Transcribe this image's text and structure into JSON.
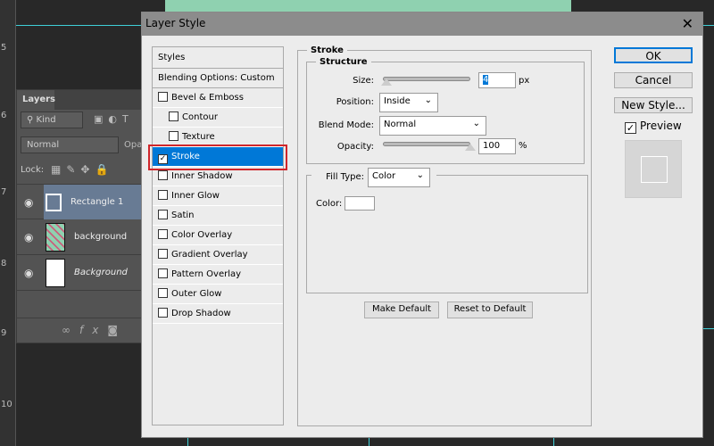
{
  "ruler": {
    "marks": [
      "5",
      "6",
      "7",
      "8",
      "9",
      "10"
    ]
  },
  "layers": {
    "tab": "Layers",
    "kind": "Kind",
    "blend": "Normal",
    "opacity_label": "Opa",
    "lock_label": "Lock:",
    "items": [
      {
        "name": "Rectangle 1",
        "selected": true
      },
      {
        "name": "background"
      },
      {
        "name": "Background"
      }
    ]
  },
  "dialog": {
    "title": "Layer Style",
    "styles_header": "Styles",
    "blending": "Blending Options: Custom",
    "effects": [
      {
        "label": "Bevel & Emboss",
        "checked": false
      },
      {
        "label": "Contour",
        "checked": false
      },
      {
        "label": "Texture",
        "checked": false
      },
      {
        "label": "Stroke",
        "checked": true,
        "selected": true
      },
      {
        "label": "Inner Shadow",
        "checked": false
      },
      {
        "label": "Inner Glow",
        "checked": false
      },
      {
        "label": "Satin",
        "checked": false
      },
      {
        "label": "Color Overlay",
        "checked": false
      },
      {
        "label": "Gradient Overlay",
        "checked": false
      },
      {
        "label": "Pattern Overlay",
        "checked": false
      },
      {
        "label": "Outer Glow",
        "checked": false
      },
      {
        "label": "Drop Shadow",
        "checked": false
      }
    ],
    "stroke": {
      "legend": "Stroke",
      "structure": "Structure",
      "size_label": "Size:",
      "size": "4",
      "size_unit": "px",
      "position_label": "Position:",
      "position": "Inside",
      "blend_label": "Blend Mode:",
      "blend": "Normal",
      "opacity_label": "Opacity:",
      "opacity": "100",
      "opacity_unit": "%",
      "fill_label": "Fill Type:",
      "fill": "Color",
      "color_label": "Color:",
      "color": "#ffffff"
    },
    "make_default": "Make Default",
    "reset_default": "Reset to Default",
    "ok": "OK",
    "cancel": "Cancel",
    "new_style": "New Style...",
    "preview": "Preview",
    "preview_checked": true
  },
  "colors": {
    "accent": "#0078d7",
    "highlight": "#d0262b"
  }
}
